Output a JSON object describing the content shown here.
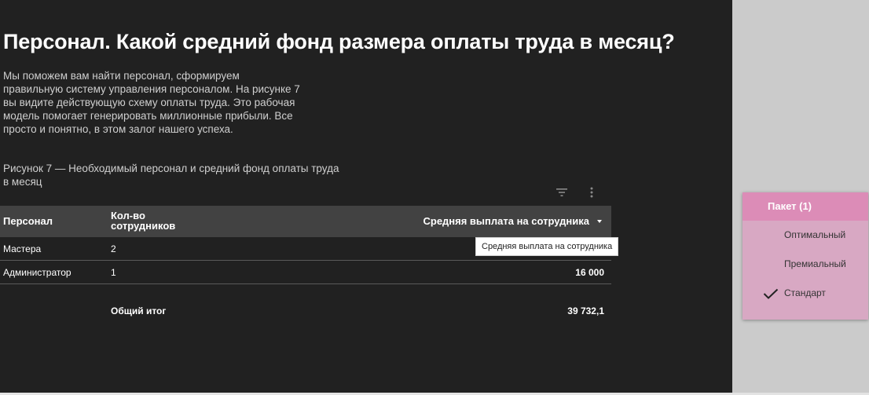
{
  "page": {
    "title": "Персонал. Какой средний фонд размера оплаты труда в месяц?",
    "intro_lines": [
      "Мы поможем вам найти персонал, сформируем",
      "правильную систему управления персоналом. На рисунке 7",
      "вы видите действующую схему оплаты труда. Это рабочая",
      "модель помогает генерировать миллионные прибыли. Все",
      "просто и понятно, в этом залог нашего успеха."
    ],
    "caption_lines": [
      "Рисунок 7 — Необходимый персонал и средний фонд оплаты труда",
      "в месяц"
    ]
  },
  "toolbar": {
    "icons": [
      "filter-icon",
      "more-vert-icon"
    ]
  },
  "table": {
    "headers": {
      "person": "Персонал",
      "count_line1": "Кол-во",
      "count_line2": "сотрудников",
      "avg": "Средняя выплата на сотрудника"
    },
    "rows": [
      {
        "person": "Мастера",
        "count": "2",
        "avg": ""
      },
      {
        "person": "Администратор",
        "count": "1",
        "avg": "16 000"
      }
    ],
    "total": {
      "label": "Общий итог",
      "avg": "39 732,1"
    }
  },
  "tooltip": {
    "text": "Средняя выплата на сотрудника"
  },
  "filter": {
    "header": "Пакет (1)",
    "options": [
      {
        "label": "Оптимальный",
        "checked": false
      },
      {
        "label": "Премиальный",
        "checked": false
      },
      {
        "label": "Стандарт",
        "checked": true
      }
    ]
  },
  "colors": {
    "panel_bg": "#212121",
    "header_bg": "#424242",
    "filter_header": "#dc8cb7",
    "filter_body": "#d8a8c3"
  }
}
